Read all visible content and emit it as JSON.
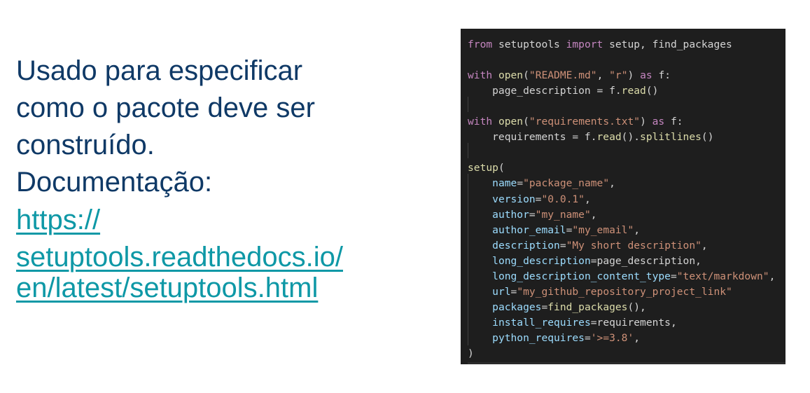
{
  "slide": {
    "lines": [
      "Usado para especificar",
      "como o pacote deve ser",
      "construído.",
      "Documentação:"
    ],
    "link_lines": [
      "https://",
      "setuptools.readthedocs.io/",
      "en/latest/setuptools.html"
    ]
  },
  "colors": {
    "text": "#0f3966",
    "link": "#0e98a6",
    "code_bg": "#1e1e1e"
  },
  "code": [
    [
      [
        "from",
        "k"
      ],
      [
        " setuptools ",
        "d"
      ],
      [
        "import",
        "k"
      ],
      [
        " setup, find_packages",
        "d"
      ]
    ],
    [],
    [
      [
        "with",
        "k"
      ],
      [
        " ",
        "d"
      ],
      [
        "open",
        "f"
      ],
      [
        "(",
        "d"
      ],
      [
        "\"README.md\"",
        "s"
      ],
      [
        ", ",
        "d"
      ],
      [
        "\"r\"",
        "s"
      ],
      [
        ") ",
        "d"
      ],
      [
        "as",
        "k"
      ],
      [
        " f:",
        "d"
      ]
    ],
    [
      [
        "    page_description = f.",
        "d"
      ],
      [
        "read",
        "f"
      ],
      [
        "()",
        "d"
      ]
    ],
    [],
    [
      [
        "with",
        "k"
      ],
      [
        " ",
        "d"
      ],
      [
        "open",
        "f"
      ],
      [
        "(",
        "d"
      ],
      [
        "\"requirements.txt\"",
        "s"
      ],
      [
        ") ",
        "d"
      ],
      [
        "as",
        "k"
      ],
      [
        " f:",
        "d"
      ]
    ],
    [
      [
        "    requirements = f.",
        "d"
      ],
      [
        "read",
        "f"
      ],
      [
        "().",
        "d"
      ],
      [
        "splitlines",
        "f"
      ],
      [
        "()",
        "d"
      ]
    ],
    [],
    [
      [
        "setup",
        "f"
      ],
      [
        "(",
        "d"
      ]
    ],
    [
      [
        "    ",
        "d"
      ],
      [
        "name",
        "p"
      ],
      [
        "=",
        "d"
      ],
      [
        "\"package_name\"",
        "s"
      ],
      [
        ",",
        "d"
      ]
    ],
    [
      [
        "    ",
        "d"
      ],
      [
        "version",
        "p"
      ],
      [
        "=",
        "d"
      ],
      [
        "\"0.0.1\"",
        "s"
      ],
      [
        ",",
        "d"
      ]
    ],
    [
      [
        "    ",
        "d"
      ],
      [
        "author",
        "p"
      ],
      [
        "=",
        "d"
      ],
      [
        "\"my_name\"",
        "s"
      ],
      [
        ",",
        "d"
      ]
    ],
    [
      [
        "    ",
        "d"
      ],
      [
        "author_email",
        "p"
      ],
      [
        "=",
        "d"
      ],
      [
        "\"my_email\"",
        "s"
      ],
      [
        ",",
        "d"
      ]
    ],
    [
      [
        "    ",
        "d"
      ],
      [
        "description",
        "p"
      ],
      [
        "=",
        "d"
      ],
      [
        "\"My short description\"",
        "s"
      ],
      [
        ",",
        "d"
      ]
    ],
    [
      [
        "    ",
        "d"
      ],
      [
        "long_description",
        "p"
      ],
      [
        "=page_description,",
        "d"
      ]
    ],
    [
      [
        "    ",
        "d"
      ],
      [
        "long_description_content_type",
        "p"
      ],
      [
        "=",
        "d"
      ],
      [
        "\"text/markdown\"",
        "s"
      ],
      [
        ",",
        "d"
      ]
    ],
    [
      [
        "    ",
        "d"
      ],
      [
        "url",
        "p"
      ],
      [
        "=",
        "d"
      ],
      [
        "\"my_github_repository_project_link\"",
        "s"
      ]
    ],
    [
      [
        "    ",
        "d"
      ],
      [
        "packages",
        "p"
      ],
      [
        "=",
        "d"
      ],
      [
        "find_packages",
        "f"
      ],
      [
        "(),",
        "d"
      ]
    ],
    [
      [
        "    ",
        "d"
      ],
      [
        "install_requires",
        "p"
      ],
      [
        "=requirements,",
        "d"
      ]
    ],
    [
      [
        "    ",
        "d"
      ],
      [
        "python_requires",
        "p"
      ],
      [
        "=",
        "d"
      ],
      [
        "'>=3.8'",
        "s"
      ],
      [
        ",",
        "d"
      ]
    ],
    [
      [
        ")",
        "d"
      ]
    ]
  ]
}
